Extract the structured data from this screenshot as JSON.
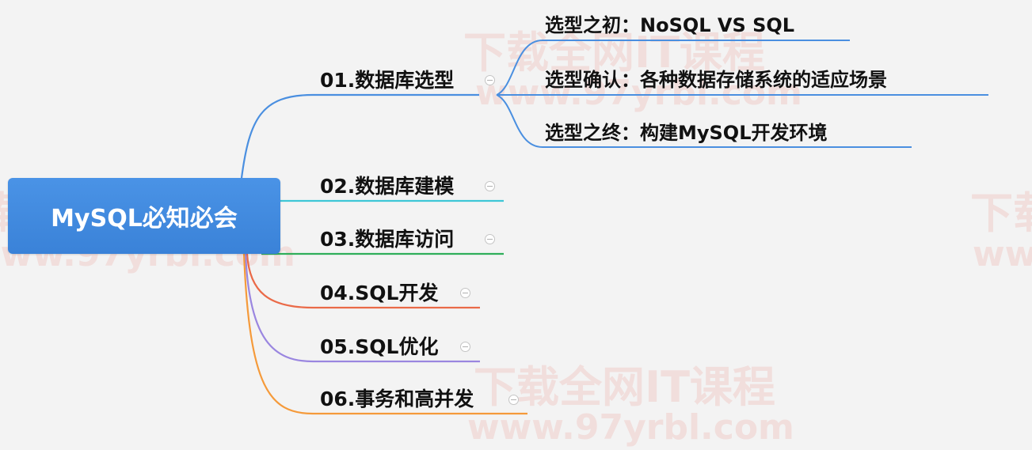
{
  "root": {
    "label": "MySQL必知必会"
  },
  "branches": [
    {
      "label": "01.数据库选型",
      "color": "#4a8fe0",
      "children": [
        {
          "label": "选型之初：NoSQL VS SQL"
        },
        {
          "label": "选型确认：各种数据存储系统的适应场景"
        },
        {
          "label": "选型之终：构建MySQL开发环境"
        }
      ]
    },
    {
      "label": "02.数据库建模",
      "color": "#3ec6d6",
      "children": []
    },
    {
      "label": "03.数据库访问",
      "color": "#2fae5a",
      "children": []
    },
    {
      "label": "04.SQL开发",
      "color": "#ea6a48",
      "children": []
    },
    {
      "label": "05.SQL优化",
      "color": "#9a86e0",
      "children": []
    },
    {
      "label": "06.事务和高并发",
      "color": "#f59a3a",
      "children": []
    }
  ],
  "watermarks": [
    {
      "text": "下载全网IT课程"
    },
    {
      "text": "www.97yrbl.com"
    }
  ]
}
